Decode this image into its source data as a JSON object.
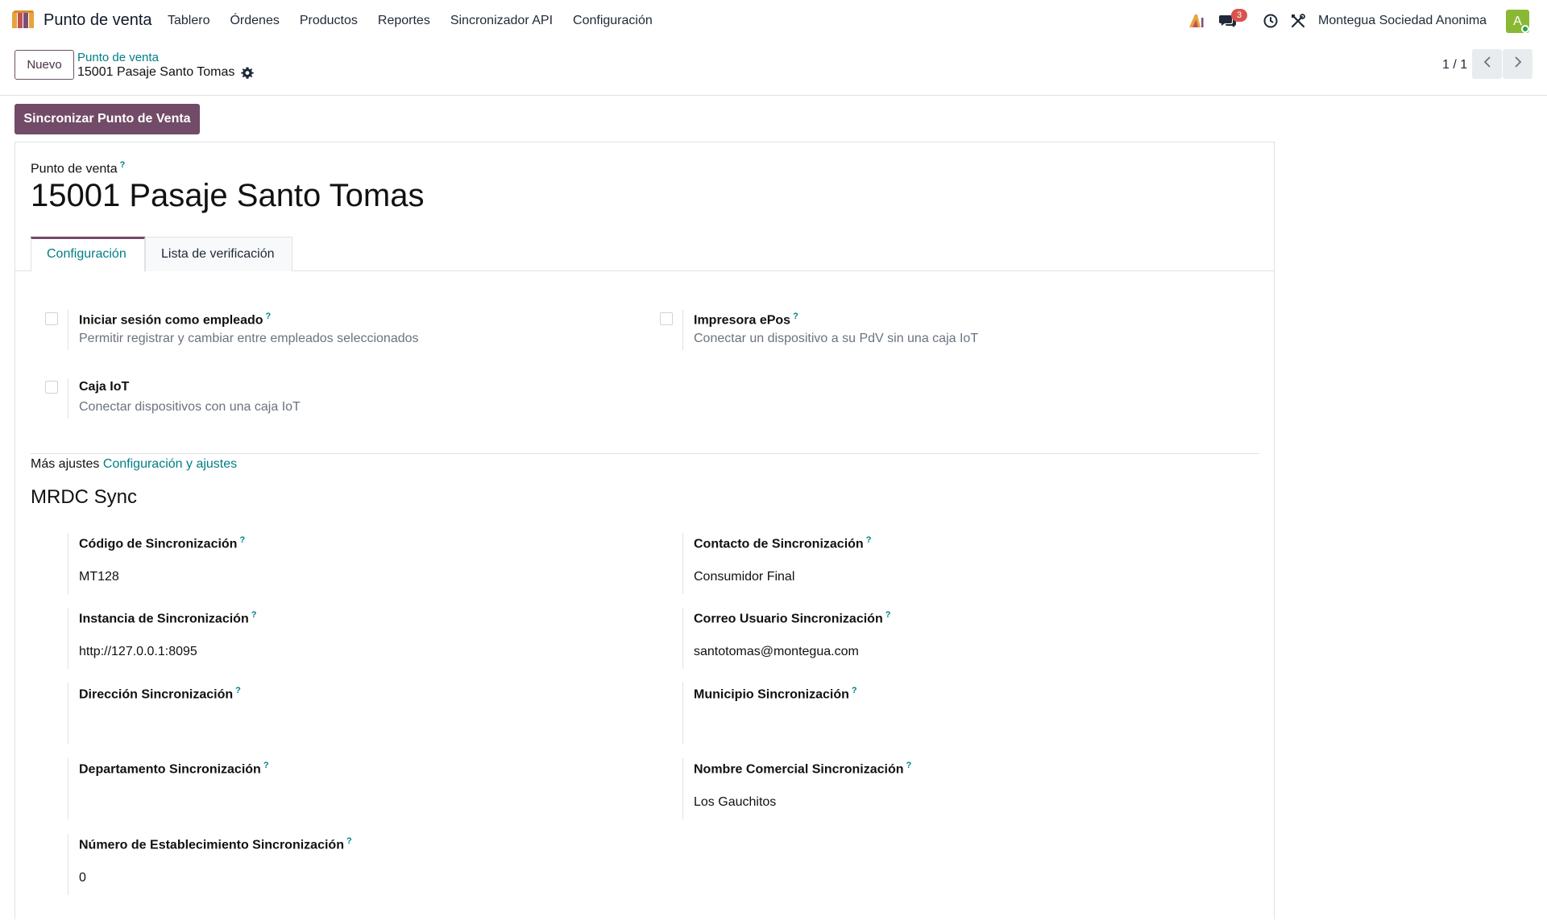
{
  "navbar": {
    "app_name": "Punto de venta",
    "menu": [
      "Tablero",
      "Órdenes",
      "Productos",
      "Reportes",
      "Sincronizador API",
      "Configuración"
    ],
    "messages_count": "3",
    "company": "Montegua Sociedad Anonima",
    "avatar_initial": "A"
  },
  "control_panel": {
    "new_label": "Nuevo",
    "breadcrumb": "Punto de venta",
    "record_title": "15001 Pasaje Santo Tomas",
    "pager": "1 / 1"
  },
  "actions": {
    "sync_button": "Sincronizar Punto de Venta"
  },
  "form": {
    "caption": "Punto de venta",
    "help_mark": "?",
    "name": "15001 Pasaje Santo Tomas",
    "tabs": [
      "Configuración",
      "Lista de verificación"
    ],
    "settings": [
      {
        "label": "Iniciar sesión como empleado",
        "description": "Permitir registrar y cambiar entre empleados seleccionados",
        "checked": false
      },
      {
        "label": "Impresora ePos",
        "description": "Conectar un dispositivo a su PdV sin una caja IoT",
        "checked": false
      },
      {
        "label": "Caja IoT",
        "description": "Conectar dispositivos con una caja IoT",
        "checked": false
      }
    ],
    "more_settings_prefix": "Más ajustes",
    "more_settings_link": "Configuración y ajustes",
    "section_title": "MRDC Sync",
    "sync_fields": {
      "codigo": {
        "label": "Código de Sincronización",
        "value": "MT128"
      },
      "contacto": {
        "label": "Contacto de Sincronización",
        "value": "Consumidor Final"
      },
      "instancia": {
        "label": "Instancia de Sincronización",
        "value": "http://127.0.0.1:8095"
      },
      "correo": {
        "label": "Correo Usuario Sincronización",
        "value": "santotomas@montegua.com"
      },
      "direccion": {
        "label": "Dirección Sincronización",
        "value": ""
      },
      "municipio": {
        "label": "Municipio Sincronización",
        "value": ""
      },
      "departamento": {
        "label": "Departamento Sincronización",
        "value": ""
      },
      "nombre_comercial": {
        "label": "Nombre Comercial Sincronización",
        "value": "Los Gauchitos"
      },
      "numero_establecimiento": {
        "label": "Número de Establecimiento Sincronización",
        "value": "0"
      }
    }
  },
  "colors": {
    "primary": "#714b67",
    "link": "#017e84",
    "badge": "#d9534f",
    "avatar": "#8bb834"
  }
}
